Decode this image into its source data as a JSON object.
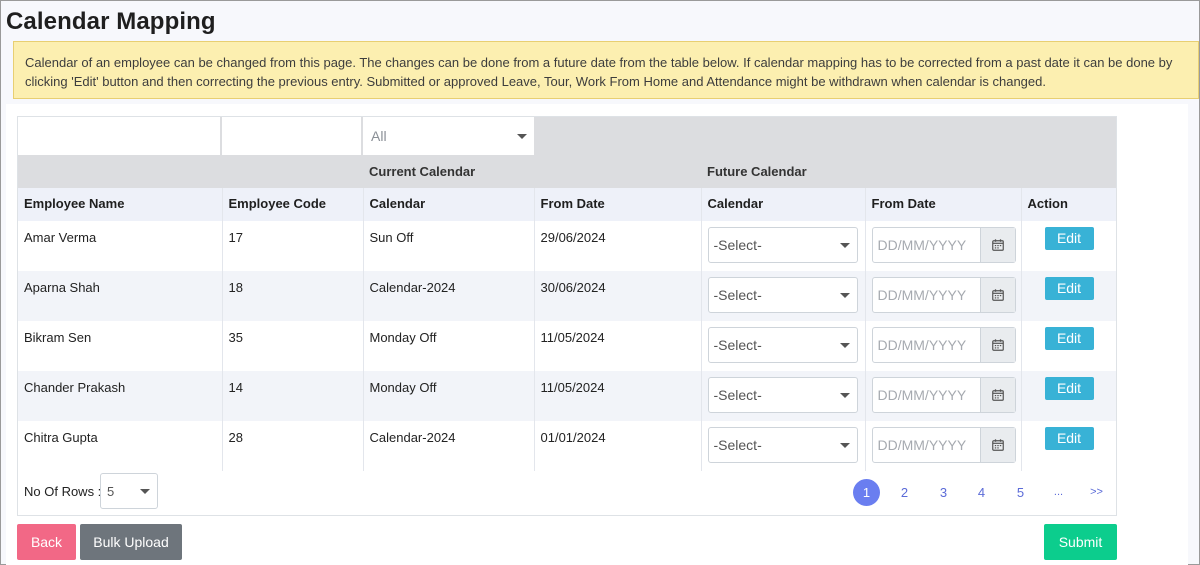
{
  "page": {
    "title": "Calendar Mapping",
    "notice": "Calendar of an employee can be changed from this page. The changes can be done from a future date from the table below. If calendar mapping has to be corrected from a past date it can be done by clicking 'Edit' button and then correcting the previous entry. Submitted or approved Leave, Tour, Work From Home and Attendance might be withdrawn when calendar is changed."
  },
  "filters": {
    "name_value": "",
    "code_value": "",
    "calendar_selected": "All"
  },
  "groups": {
    "current": "Current Calendar",
    "future": "Future Calendar"
  },
  "columns": {
    "employee_name": "Employee Name",
    "employee_code": "Employee Code",
    "current_calendar": "Calendar",
    "current_from_date": "From Date",
    "future_calendar": "Calendar",
    "future_from_date": "From Date",
    "action": "Action"
  },
  "rows": [
    {
      "name": "Amar Verma",
      "code": "17",
      "calendar": "Sun Off",
      "from_date": "29/06/2024",
      "future_calendar": "-Select-",
      "future_date_placeholder": "DD/MM/YYYY",
      "action": "Edit"
    },
    {
      "name": "Aparna Shah",
      "code": "18",
      "calendar": "Calendar-2024",
      "from_date": "30/06/2024",
      "future_calendar": "-Select-",
      "future_date_placeholder": "DD/MM/YYYY",
      "action": "Edit"
    },
    {
      "name": "Bikram Sen",
      "code": "35",
      "calendar": "Monday Off",
      "from_date": "11/05/2024",
      "future_calendar": "-Select-",
      "future_date_placeholder": "DD/MM/YYYY",
      "action": "Edit"
    },
    {
      "name": "Chander Prakash",
      "code": "14",
      "calendar": "Monday Off",
      "from_date": "11/05/2024",
      "future_calendar": "-Select-",
      "future_date_placeholder": "DD/MM/YYYY",
      "action": "Edit"
    },
    {
      "name": "Chitra Gupta",
      "code": "28",
      "calendar": "Calendar-2024",
      "from_date": "01/01/2024",
      "future_calendar": "-Select-",
      "future_date_placeholder": "DD/MM/YYYY",
      "action": "Edit"
    }
  ],
  "pagination": {
    "rows_label": "No Of Rows :",
    "rows_value": "5",
    "pages": [
      "1",
      "2",
      "3",
      "4",
      "5",
      "...",
      ">>"
    ],
    "active_page": "1"
  },
  "buttons": {
    "back": "Back",
    "bulk_upload": "Bulk Upload",
    "submit": "Submit"
  },
  "colors": {
    "back": "#f26886",
    "bulk_upload": "#6e757c",
    "submit": "#0ccd8d",
    "edit": "#38b2d6",
    "active_page": "#6a7ef0",
    "notice_bg": "#fcefb0"
  },
  "icons": {
    "dropdown": "chevron-down-icon",
    "date_picker": "calendar-icon"
  }
}
